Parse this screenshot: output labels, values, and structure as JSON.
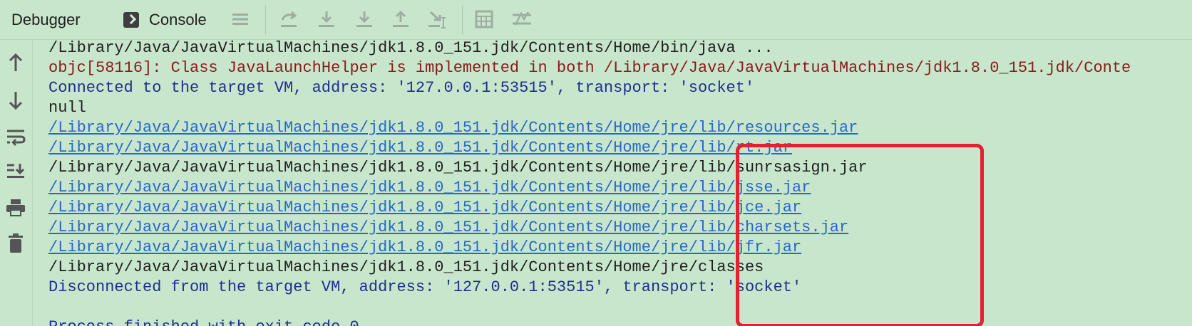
{
  "tabs": {
    "debugger": "Debugger",
    "console": "Console"
  },
  "toolbar_icons": [
    "menu-icon",
    "step-over-icon",
    "step-into-icon",
    "force-step-into-icon",
    "step-out-icon",
    "run-to-cursor-icon",
    "evaluate-icon",
    "trace-icon"
  ],
  "sidebar_icons": [
    "up-arrow-icon",
    "down-arrow-icon",
    "soft-wrap-icon",
    "scroll-to-end-icon",
    "print-icon",
    "trash-icon"
  ],
  "console": {
    "lines": [
      {
        "text": "/Library/Java/JavaVirtualMachines/jdk1.8.0_151.jdk/Contents/Home/bin/java ...",
        "style": "default"
      },
      {
        "text": "objc[58116]: Class JavaLaunchHelper is implemented in both /Library/Java/JavaVirtualMachines/jdk1.8.0_151.jdk/Conte",
        "style": "error"
      },
      {
        "text": "Connected to the target VM, address: '127.0.0.1:53515', transport: 'socket'",
        "style": "system"
      },
      {
        "text": "null",
        "style": "default"
      },
      {
        "text": "/Library/Java/JavaVirtualMachines/jdk1.8.0_151.jdk/Contents/Home/jre/lib/resources.jar",
        "style": "link"
      },
      {
        "text": "/Library/Java/JavaVirtualMachines/jdk1.8.0_151.jdk/Contents/Home/jre/lib/rt.jar",
        "style": "link"
      },
      {
        "text": "/Library/Java/JavaVirtualMachines/jdk1.8.0_151.jdk/Contents/Home/jre/lib/sunrsasign.jar",
        "style": "default"
      },
      {
        "text": "/Library/Java/JavaVirtualMachines/jdk1.8.0_151.jdk/Contents/Home/jre/lib/jsse.jar",
        "style": "link"
      },
      {
        "text": "/Library/Java/JavaVirtualMachines/jdk1.8.0_151.jdk/Contents/Home/jre/lib/jce.jar",
        "style": "link"
      },
      {
        "text": "/Library/Java/JavaVirtualMachines/jdk1.8.0_151.jdk/Contents/Home/jre/lib/charsets.jar",
        "style": "link"
      },
      {
        "text": "/Library/Java/JavaVirtualMachines/jdk1.8.0_151.jdk/Contents/Home/jre/lib/jfr.jar",
        "style": "link"
      },
      {
        "text": "/Library/Java/JavaVirtualMachines/jdk1.8.0_151.jdk/Contents/Home/jre/classes",
        "style": "default"
      },
      {
        "text": "Disconnected from the target VM, address: '127.0.0.1:53515', transport: 'socket'",
        "style": "system"
      },
      {
        "text": "",
        "style": "default"
      },
      {
        "text": "Process finished with exit code 0",
        "style": "system"
      }
    ]
  },
  "colors": {
    "background": "#c8e6cc",
    "highlight": "#e3212f",
    "link": "#2768c9",
    "system": "#1f2f8f",
    "error": "#8b1a1a"
  }
}
